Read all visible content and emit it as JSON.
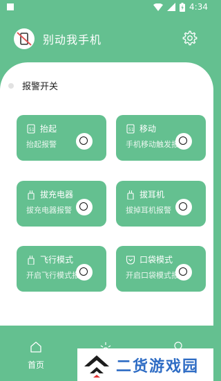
{
  "status_bar": {
    "time": "4:34"
  },
  "header": {
    "title": "别动我手机"
  },
  "alarm": {
    "label": "报警开关"
  },
  "modes": [
    {
      "title": "抬起",
      "desc": "抬起报警",
      "icon": "phone-lift-icon"
    },
    {
      "title": "移动",
      "desc": "手机移动触发报警",
      "icon": "phone-move-icon"
    },
    {
      "title": "拔充电器",
      "desc": "拔充电器报警",
      "icon": "charger-plug-icon"
    },
    {
      "title": "拔耳机",
      "desc": "拔掉耳机报警",
      "icon": "earphone-plug-icon"
    },
    {
      "title": "飞行模式",
      "desc": "开启飞行模式报警",
      "icon": "airplane-mode-icon"
    },
    {
      "title": "口袋模式",
      "desc": "开启口袋模式报警",
      "icon": "pocket-icon"
    }
  ],
  "nav": {
    "home_label": "首页"
  },
  "watermark": {
    "text": "二货游戏园"
  },
  "colors": {
    "brand": "#64c090",
    "watermark_blue": "#2e6cc4"
  }
}
